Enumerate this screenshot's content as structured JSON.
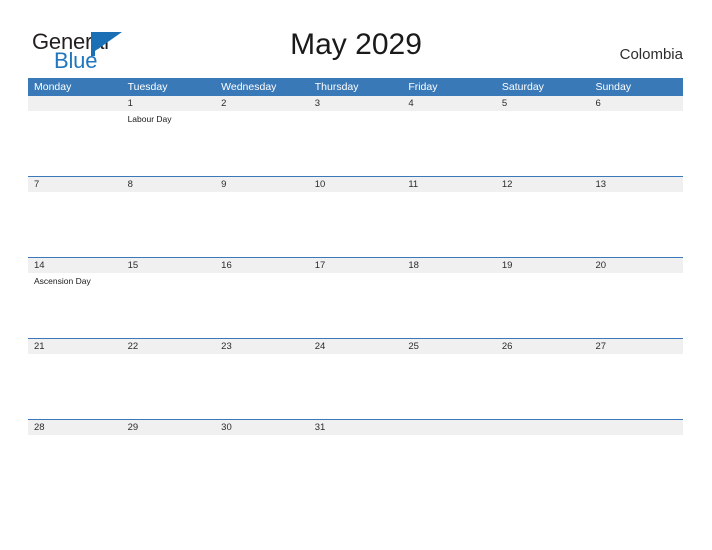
{
  "brand": {
    "name_part1": "General",
    "name_part2": "Blue",
    "flag_icon": "flag-triangle-icon",
    "colors": {
      "dark_text": "#231f20",
      "blue_text": "#2077c0",
      "flag_blue": "#1b6fb5"
    }
  },
  "header": {
    "title": "May 2029",
    "country": "Colombia"
  },
  "theme": {
    "header_blue": "#3a79b8",
    "date_band_gray": "#f0f0f0",
    "cell_white": "#ffffff",
    "row_divider": "#3a79b8"
  },
  "calendar": {
    "month": "May",
    "year": "2029",
    "weekday_headers": [
      "Monday",
      "Tuesday",
      "Wednesday",
      "Thursday",
      "Friday",
      "Saturday",
      "Sunday"
    ],
    "weeks": [
      {
        "days": [
          {
            "date": "",
            "events": []
          },
          {
            "date": "1",
            "events": [
              "Labour Day"
            ]
          },
          {
            "date": "2",
            "events": []
          },
          {
            "date": "3",
            "events": []
          },
          {
            "date": "4",
            "events": []
          },
          {
            "date": "5",
            "events": []
          },
          {
            "date": "6",
            "events": []
          }
        ]
      },
      {
        "days": [
          {
            "date": "7",
            "events": []
          },
          {
            "date": "8",
            "events": []
          },
          {
            "date": "9",
            "events": []
          },
          {
            "date": "10",
            "events": []
          },
          {
            "date": "11",
            "events": []
          },
          {
            "date": "12",
            "events": []
          },
          {
            "date": "13",
            "events": []
          }
        ]
      },
      {
        "days": [
          {
            "date": "14",
            "events": [
              "Ascension Day"
            ]
          },
          {
            "date": "15",
            "events": []
          },
          {
            "date": "16",
            "events": []
          },
          {
            "date": "17",
            "events": []
          },
          {
            "date": "18",
            "events": []
          },
          {
            "date": "19",
            "events": []
          },
          {
            "date": "20",
            "events": []
          }
        ]
      },
      {
        "days": [
          {
            "date": "21",
            "events": []
          },
          {
            "date": "22",
            "events": []
          },
          {
            "date": "23",
            "events": []
          },
          {
            "date": "24",
            "events": []
          },
          {
            "date": "25",
            "events": []
          },
          {
            "date": "26",
            "events": []
          },
          {
            "date": "27",
            "events": []
          }
        ]
      },
      {
        "days": [
          {
            "date": "28",
            "events": []
          },
          {
            "date": "29",
            "events": []
          },
          {
            "date": "30",
            "events": []
          },
          {
            "date": "31",
            "events": []
          },
          {
            "date": "",
            "events": []
          },
          {
            "date": "",
            "events": []
          },
          {
            "date": "",
            "events": []
          }
        ]
      }
    ]
  }
}
